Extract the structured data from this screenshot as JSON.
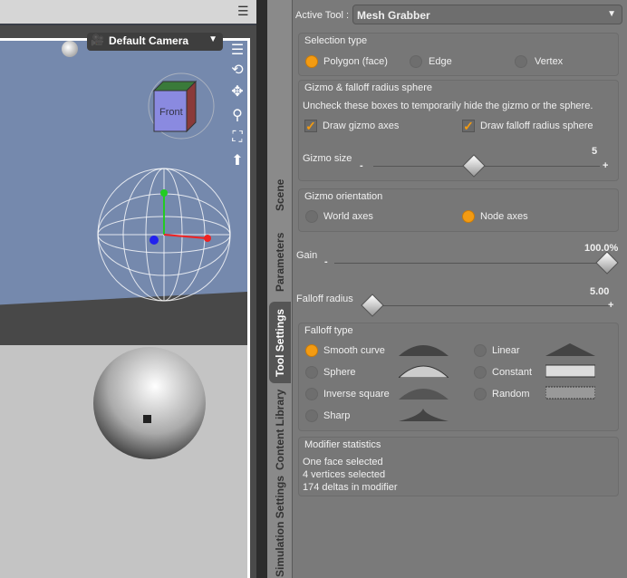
{
  "viewport": {
    "camera_label": "Default Camera",
    "cube_label": "Front"
  },
  "tabs": [
    "Scene",
    "Parameters",
    "Tool Settings",
    "Content Library",
    "Simulation Settings"
  ],
  "active_tab": "Tool Settings",
  "panel": {
    "active_tool_label": "Active Tool :",
    "active_tool": "Mesh Grabber",
    "selection_type": {
      "title": "Selection type",
      "options": [
        "Polygon (face)",
        "Edge",
        "Vertex"
      ],
      "selected": "Polygon (face)"
    },
    "gizmo_sphere": {
      "title": "Gizmo & falloff radius sphere",
      "hint": "Uncheck these boxes to temporarily hide the gizmo or the sphere.",
      "draw_gizmo": "Draw gizmo axes",
      "draw_sphere": "Draw falloff radius sphere",
      "gizmo_size_label": "Gizmo size",
      "gizmo_size": "5",
      "minus": "-",
      "plus": "+"
    },
    "gizmo_orientation": {
      "title": "Gizmo orientation",
      "options": [
        "World axes",
        "Node axes"
      ],
      "selected": "Node axes"
    },
    "gain": {
      "label": "Gain",
      "value": "100.0%",
      "fraction": 1.0
    },
    "falloff_radius": {
      "label": "Falloff radius",
      "value": "5.00",
      "fraction": 0.0
    },
    "falloff_type": {
      "title": "Falloff type",
      "options": [
        "Smooth curve",
        "Sphere",
        "Inverse square",
        "Sharp",
        "Linear",
        "Constant",
        "Random"
      ],
      "selected": "Smooth curve"
    },
    "stats": {
      "title": "Modifier statistics",
      "lines": [
        "One face selected",
        "4 vertices selected",
        "174 deltas in modifier"
      ]
    }
  }
}
